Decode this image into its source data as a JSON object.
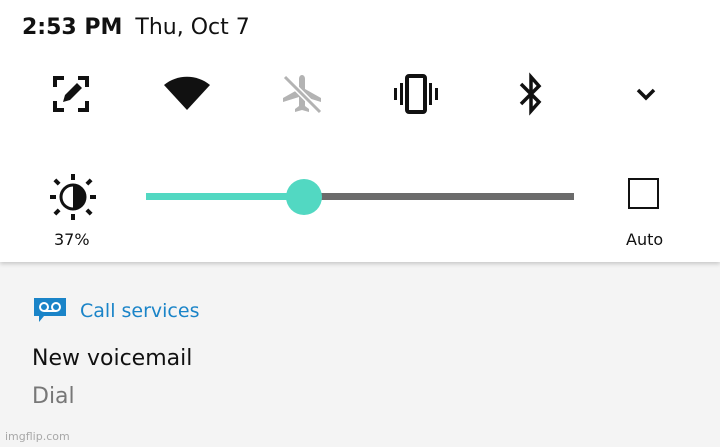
{
  "status": {
    "time": "2:53 PM",
    "date": "Thu, Oct 7"
  },
  "quick_settings": {
    "tiles": [
      {
        "icon": "edit-icon",
        "state": "on"
      },
      {
        "icon": "wifi-icon",
        "state": "on"
      },
      {
        "icon": "airplane-mode-off-icon",
        "state": "off"
      },
      {
        "icon": "vibrate-icon",
        "state": "on"
      },
      {
        "icon": "bluetooth-icon",
        "state": "on"
      },
      {
        "icon": "chevron-down-icon",
        "state": "on"
      }
    ]
  },
  "brightness": {
    "percent_label": "37%",
    "level": 0.37,
    "auto_label": "Auto",
    "auto_checked": false
  },
  "notification": {
    "app_name": "Call services",
    "title": "New voicemail",
    "text": "Dial"
  },
  "watermark": "imgflip.com",
  "colors": {
    "accent": "#52d8c2",
    "app_blue": "#1a84c8",
    "track": "#6b6b6b",
    "disabled": "#b3b3b3"
  }
}
